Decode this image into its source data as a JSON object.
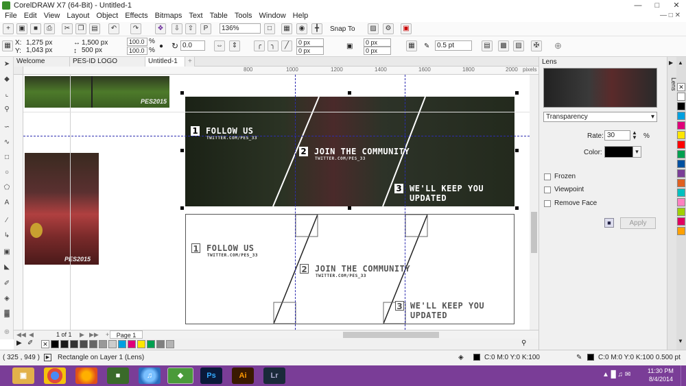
{
  "app": {
    "title": "CorelDRAW X7 (64-Bit) - Untitled-1"
  },
  "menu": [
    "File",
    "Edit",
    "View",
    "Layout",
    "Object",
    "Effects",
    "Bitmaps",
    "Text",
    "Table",
    "Tools",
    "Window",
    "Help"
  ],
  "toolbar": {
    "zoom": "136%",
    "snap_to": "Snap To"
  },
  "props": {
    "x": "1,275 px",
    "y": "1,043 px",
    "w": "1,500 px",
    "h": "500 px",
    "sx": "100.0",
    "sy": "100.0",
    "pct": "%",
    "angle": "0.0",
    "p1": "0 px",
    "p2": "0 px",
    "p3": "0 px",
    "p4": "0 px",
    "outline": "0.5 pt",
    "x_label": "X:",
    "y_label": "Y:"
  },
  "tabs": [
    "Welcome Screen",
    "PES-ID LOGO FINAL.cdr",
    "Untitled-1"
  ],
  "ruler": [
    "800",
    "1000",
    "1200",
    "1400",
    "1600",
    "1800",
    "2000"
  ],
  "ruler_unit": "pixels",
  "page": {
    "counter": "1 of 1",
    "tab": "Page 1"
  },
  "docker": {
    "title": "Lens",
    "type": "Transparency",
    "rate_label": "Rate:",
    "rate": "30",
    "rate_unit": "%",
    "color_label": "Color:",
    "frozen": "Frozen",
    "viewpoint": "Viewpoint",
    "remove_face": "Remove Face",
    "apply": "Apply",
    "side_tab": "Lens"
  },
  "banner": {
    "n1": "1",
    "t1": "FOLLOW US",
    "h1": "TWITTER.COM/PES_33",
    "n2": "2",
    "t2": "JOIN THE COMMUNITY",
    "h2": "TWITTER.COM/PES_33",
    "n3": "3",
    "t3": "WE'LL KEEP YOU UPDATED"
  },
  "thumb": {
    "logo": "PES2015"
  },
  "status": {
    "coords": "( 325 , 949 )",
    "object": "Rectangle on Layer 1 (Lens)",
    "fill": "C:0 M:0 Y:0 K:100",
    "outline": "C:0 M:0 Y:0 K:100 0.500 pt"
  },
  "taskbar": {
    "ps": "Ps",
    "ai": "Ai",
    "lr": "Lr",
    "time": "11:30 PM",
    "date": "8/4/2014"
  },
  "colors": {
    "taskbar": "#7a3d97",
    "guide": "#2c2cb0"
  }
}
